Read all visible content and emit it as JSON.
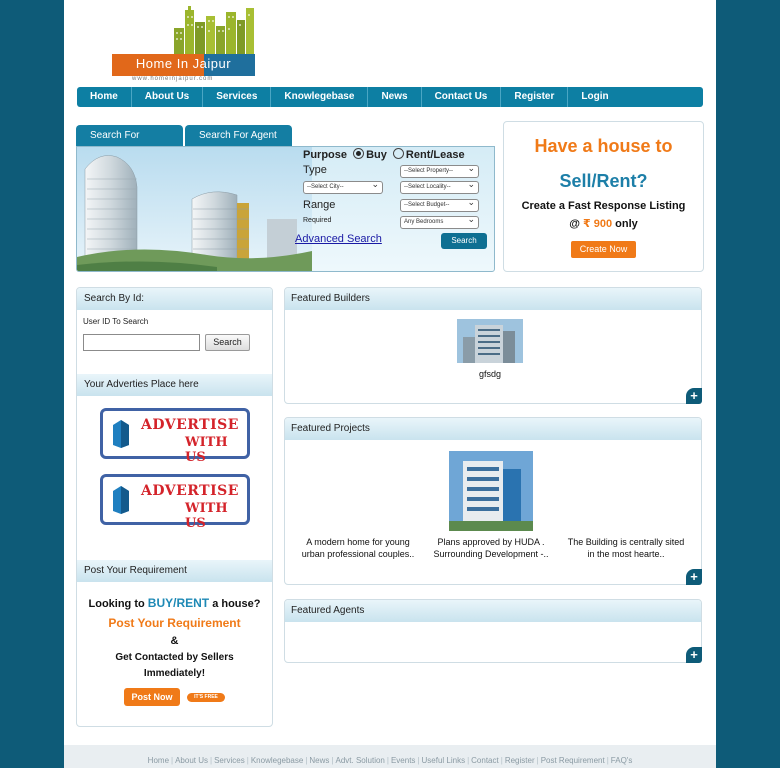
{
  "logo": {
    "name": "Home In Jaipur",
    "url_text": "www.homeinjaipur.com"
  },
  "nav": [
    "Home",
    "About Us",
    "Services",
    "Knowlegebase",
    "News",
    "Contact Us",
    "Register",
    "Login"
  ],
  "search": {
    "tabs": [
      "Search For",
      "Search For Agent"
    ],
    "purpose_label": "Purpose",
    "options": [
      "Buy",
      "Rent/Lease"
    ],
    "type_label": "Type",
    "range_label": "Range",
    "required_label": "Required",
    "selects": {
      "property": "--Select Property--",
      "city": "--Select City--",
      "locality": "--Select Locality--",
      "budget": "--Select Budget--",
      "bedrooms": "Any Bedrooms"
    },
    "advanced_link": "Advanced Search",
    "button": "Search"
  },
  "promo": {
    "line1": "Have a house to",
    "line2": "Sell/Rent?",
    "sub": "Create a Fast Response Listing",
    "price_prefix": "@",
    "price_amount": "₹ 900",
    "price_suffix": "only",
    "button": "Create Now"
  },
  "sidebar": {
    "search_by_id": {
      "title": "Search By Id:",
      "label": "User ID To Search",
      "button": "Search"
    },
    "ads": {
      "title": "Your Adverties Place here",
      "ad_line1": "ADVERTISE",
      "ad_line2": "WITH US"
    },
    "requirement": {
      "title": "Post Your Requirement",
      "line1_pre": "Looking to",
      "line1_hi": "BUY/RENT",
      "line1_post": "a house?",
      "line2": "Post Your Requirement",
      "line3": "&",
      "line4": "Get Contacted by Sellers",
      "line5": "Immediately!",
      "button": "Post Now",
      "tag": "IT'S FREE"
    }
  },
  "featured_builders": {
    "title": "Featured Builders",
    "items": [
      {
        "name": "gfsdg"
      }
    ]
  },
  "featured_projects": {
    "title": "Featured Projects",
    "items": [
      {
        "line1": "A modern home for young",
        "line2": "urban professional couples.."
      },
      {
        "line1": "Plans approved by HUDA .",
        "line2": "Surrounding Development -.."
      },
      {
        "line1": "The Building is centrally sited",
        "line2": "in the most hearte.."
      }
    ]
  },
  "featured_agents": {
    "title": "Featured Agents"
  },
  "footer": [
    "Home",
    "About Us",
    "Services",
    "Knowlegebase",
    "News",
    "Advt. Solution",
    "Events",
    "Useful Links",
    "Contact",
    "Register",
    "Post Requirement",
    "FAQ's"
  ],
  "colors": {
    "background": "#0e5b78",
    "nav": "#0d7fa3",
    "accent_orange": "#f07a18",
    "accent_blue": "#1d7fa8"
  }
}
